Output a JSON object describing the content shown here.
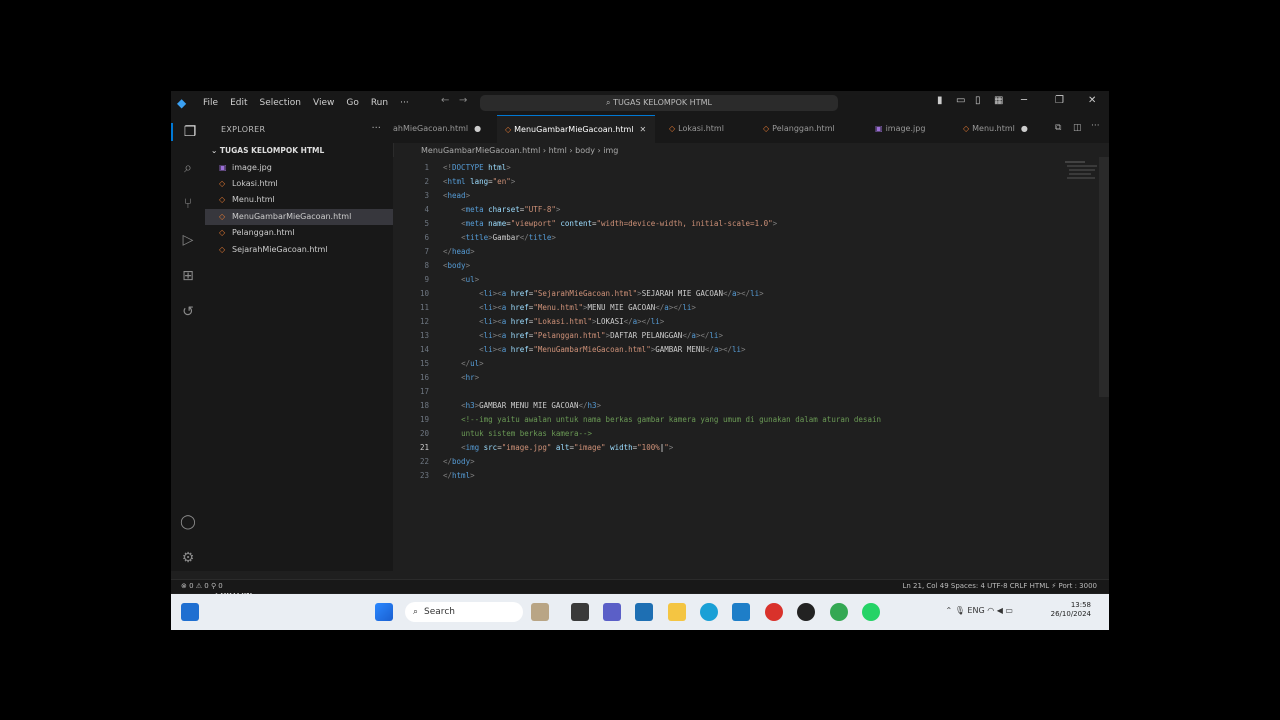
{
  "titlebar": {
    "menu": [
      "File",
      "Edit",
      "Selection",
      "View",
      "Go",
      "Run",
      "···"
    ],
    "command_center": "TUGAS KELOMPOK HTML"
  },
  "sidebar": {
    "header": "EXPLORER",
    "folder": "TUGAS KELOMPOK HTML",
    "files": [
      "image.jpg",
      "Lokasi.html",
      "Menu.html",
      "MenuGambarMieGacoan.html",
      "Pelanggan.html",
      "SejarahMieGacoan.html"
    ],
    "selected": "MenuGambarMieGacoan.html",
    "outline": "OUTLINE"
  },
  "tabs": [
    {
      "label": "ahMieGacoan.html",
      "state": "dot"
    },
    {
      "label": "MenuGambarMieGacoan.html",
      "state": "active"
    },
    {
      "label": "Lokasi.html",
      "state": ""
    },
    {
      "label": "Pelanggan.html",
      "state": ""
    },
    {
      "label": "image.jpg",
      "state": ""
    },
    {
      "label": "Menu.html",
      "state": "dot"
    }
  ],
  "breadcrumb": {
    "file": "MenuGambarMieGacoan.html",
    "html": "html",
    "body": "body",
    "img": "img"
  },
  "editor": {
    "current_line": 21,
    "lines": [
      "1",
      "2",
      "3",
      "4",
      "5",
      "6",
      "7",
      "8",
      "9",
      "10",
      "11",
      "12",
      "13",
      "14",
      "15",
      "16",
      "17",
      "18",
      "19",
      "20",
      "21",
      "22",
      "23"
    ]
  },
  "statusbar": {
    "left": "⊗ 0 ⚠ 0    ⚲ 0",
    "right": "Ln 21, Col 49    Spaces: 4    UTF-8    CRLF    HTML    ⚡ Port : 3000"
  },
  "taskbar": {
    "search_label": "Search",
    "lang": "ENG",
    "time": "13:58",
    "date": "26/10/2024"
  },
  "colors": {
    "accent": "#0078d4",
    "editor_bg": "#1f1f1f",
    "taskbar_bg": "#eaeef3"
  }
}
